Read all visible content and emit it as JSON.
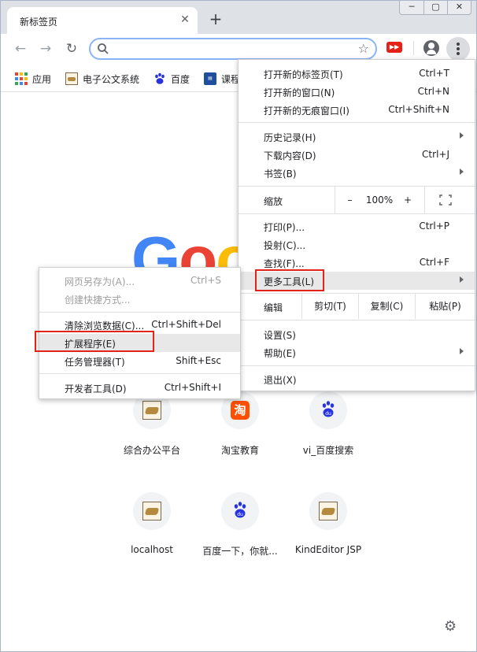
{
  "browser": {
    "tab_title": "新标签页",
    "tab_close": "✕",
    "new_tab": "+",
    "window_controls": [
      "─",
      "▢",
      "✕"
    ]
  },
  "toolbar": {
    "back_icon": "←",
    "forward_icon": "→",
    "reload_icon": "↻",
    "omnibox_value": "",
    "star_icon": "☆"
  },
  "bookmarks": [
    {
      "label": "应用",
      "icon": "apps-grid-icon"
    },
    {
      "label": "电子公文系统",
      "icon": "tomcat-icon"
    },
    {
      "label": "百度",
      "icon": "baidu-paw-icon"
    },
    {
      "label": "课程",
      "icon": "course-icon"
    }
  ],
  "bookmark_course_icon_text": "课程",
  "new_tab_page": {
    "logo_text": "Goo",
    "logo_colors": [
      "#4285f4",
      "#ea4335",
      "#fbbc05"
    ],
    "tiles": [
      {
        "label": "综合办公平台",
        "icon": "tomcat-icon"
      },
      {
        "label": "淘宝教育",
        "icon": "taobao-icon",
        "icon_text": "淘"
      },
      {
        "label": "vi_百度搜索",
        "icon": "baidu-paw-icon"
      },
      {
        "label": "localhost",
        "icon": "tomcat-icon"
      },
      {
        "label": "百度一下，你就...",
        "icon": "baidu-paw-icon"
      },
      {
        "label": "KindEditor JSP",
        "icon": "tomcat-icon"
      }
    ],
    "customize_icon": "⚙"
  },
  "menu": {
    "items_group1": [
      {
        "label": "打开新的标签页(T)",
        "shortcut": "Ctrl+T"
      },
      {
        "label": "打开新的窗口(N)",
        "shortcut": "Ctrl+N"
      },
      {
        "label": "打开新的无痕窗口(I)",
        "shortcut": "Ctrl+Shift+N"
      }
    ],
    "items_group2": [
      {
        "label": "历史记录(H)",
        "shortcut": ""
      },
      {
        "label": "下载内容(D)",
        "shortcut": "Ctrl+J"
      },
      {
        "label": "书签(B)",
        "shortcut": ""
      }
    ],
    "zoom": {
      "label": "缩放",
      "minus": "–",
      "value": "100%",
      "plus": "+"
    },
    "items_group3": [
      {
        "label": "打印(P)...",
        "shortcut": "Ctrl+P"
      },
      {
        "label": "投射(C)...",
        "shortcut": ""
      },
      {
        "label": "查找(F)...",
        "shortcut": "Ctrl+F"
      },
      {
        "label": "更多工具(L)",
        "shortcut": ""
      }
    ],
    "edit": {
      "label": "编辑",
      "cut": "剪切(T)",
      "copy": "复制(C)",
      "paste": "粘贴(P)"
    },
    "items_group4": [
      {
        "label": "设置(S)",
        "shortcut": ""
      },
      {
        "label": "帮助(E)",
        "shortcut": ""
      }
    ],
    "exit": {
      "label": "退出(X)"
    }
  },
  "submenu": {
    "items_group1": [
      {
        "label": "网页另存为(A)...",
        "shortcut": "Ctrl+S"
      },
      {
        "label": "创建快捷方式...",
        "shortcut": ""
      }
    ],
    "items_group2": [
      {
        "label": "清除浏览数据(C)...",
        "shortcut": "Ctrl+Shift+Del"
      },
      {
        "label": "扩展程序(E)",
        "shortcut": ""
      },
      {
        "label": "任务管理器(T)",
        "shortcut": "Shift+Esc"
      }
    ],
    "items_group3": [
      {
        "label": "开发者工具(D)",
        "shortcut": "Ctrl+Shift+I"
      }
    ]
  },
  "colors": {
    "highlight_box": "#e2231a",
    "hover_bg": "#e8e8e8",
    "tabstrip_bg": "#dee1e6"
  }
}
